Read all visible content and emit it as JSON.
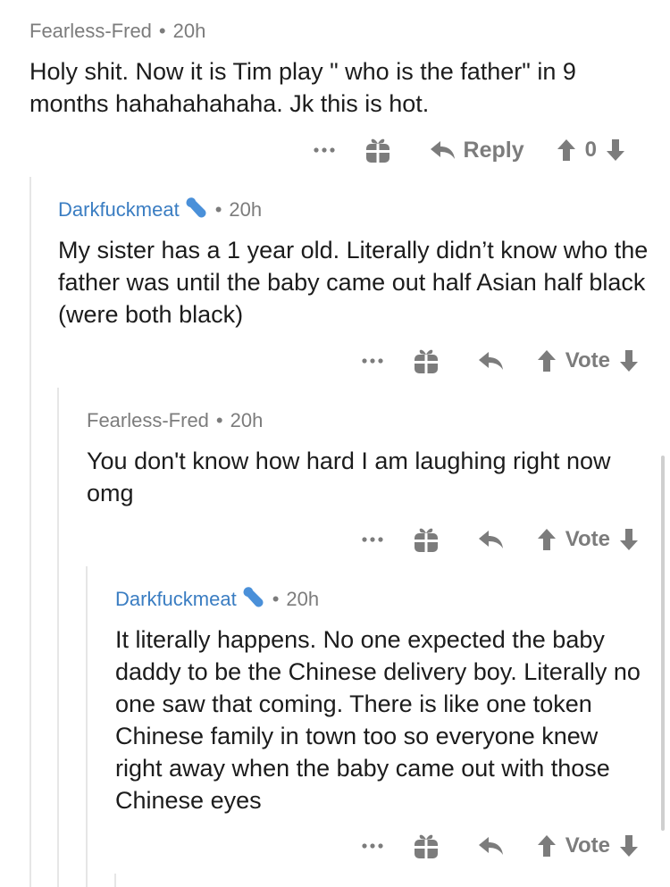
{
  "comments": [
    {
      "user": "Fearless-Fred",
      "time": "20h",
      "text": "Holy shit. Now it is Tim play \" who is the father\" in 9 months hahahahahaha. Jk this is hot.",
      "reply_label": "Reply",
      "score": "0"
    },
    {
      "user": "Darkfuckmeat",
      "time": "20h",
      "text": "My sister has a 1 year old. Literally didn’t know who the father was until the baby came out half Asian half black (were both black)",
      "vote_label": "Vote"
    },
    {
      "user": "Fearless-Fred",
      "time": "20h",
      "text": "You don't know how hard I am laughing right now omg",
      "vote_label": "Vote"
    },
    {
      "user": "Darkfuckmeat",
      "time": "20h",
      "text": "It literally happens. No one expected the baby daddy to be the Chinese delivery boy. Literally no one saw that coming. There is like one token Chinese family in town too so everyone knew right away when the baby came out with those Chinese eyes",
      "vote_label": "Vote"
    }
  ],
  "colors": {
    "username_op": "#7c7c7c",
    "username_link": "#3a7dc2",
    "icon_gray": "#7c7c7c",
    "thread_line": "#e6e6e6"
  },
  "icons": [
    "more-icon",
    "gift-icon",
    "reply-arrow-icon",
    "upvote-icon",
    "downvote-icon",
    "wrench-icon"
  ]
}
